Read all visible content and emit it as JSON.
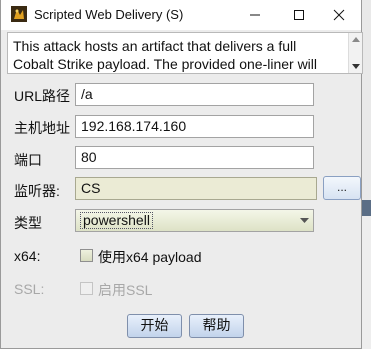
{
  "window": {
    "title": "Scripted Web Delivery (S)"
  },
  "description": {
    "line1": "This attack hosts an artifact that delivers a full",
    "line2": "Cobalt Strike payload. The provided one-liner will"
  },
  "form": {
    "url_path": {
      "label": "URL路径",
      "value": "/a"
    },
    "host": {
      "label": "主机地址",
      "value": "192.168.174.160"
    },
    "port": {
      "label": "端口",
      "value": "80"
    },
    "listener": {
      "label": "监听器:",
      "value": "CS",
      "browse_label": "..."
    },
    "type": {
      "label": "类型",
      "selected": "powershell"
    },
    "x64": {
      "label": "x64:",
      "checkbox_label": "使用x64 payload",
      "checked": false
    },
    "ssl": {
      "label": "SSL:",
      "checkbox_label": "启用SSL",
      "checked": false,
      "enabled": false
    }
  },
  "buttons": {
    "start": "开始",
    "help": "帮助"
  },
  "icons": {
    "app": "cobalt-strike-app-icon",
    "minimize": "minimize-icon",
    "maximize": "maximize-icon",
    "close": "close-icon",
    "dropdown": "chevron-down-icon"
  },
  "colors": {
    "readonly_field": "#ebebd5",
    "button_face": "#c2d3eb",
    "window_bg": "#ececec"
  }
}
